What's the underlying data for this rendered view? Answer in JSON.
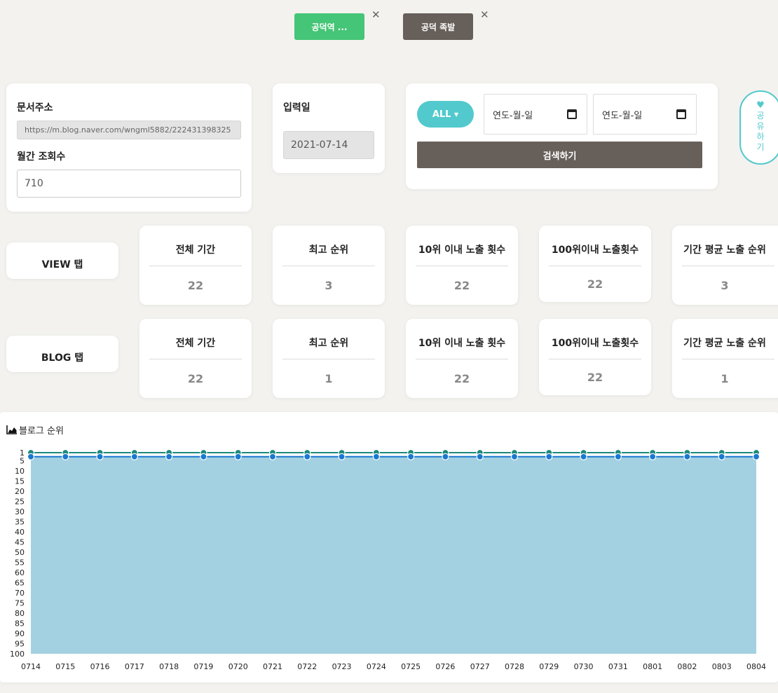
{
  "tags": [
    {
      "label": "공덕역 ...",
      "color": "#45c577"
    },
    {
      "label": "공덕 족발",
      "color": "#675f59"
    }
  ],
  "doc": {
    "url_label": "문서주소",
    "url_value": "https://m.blog.naver.com/wngml5882/222431398325",
    "views_label": "월간 조회수",
    "views_value": "710"
  },
  "entry": {
    "label": "입력일",
    "value": "2021-07-14"
  },
  "search": {
    "all_label": "ALL",
    "date_placeholder": "연도-월-일",
    "button_label": "검색하기"
  },
  "share": {
    "chars": [
      "공",
      "유",
      "하",
      "기"
    ]
  },
  "tabs": [
    {
      "label": "VIEW 탭",
      "stats": [
        {
          "title": "전체 기간",
          "value": "22"
        },
        {
          "title": "최고 순위",
          "value": "3"
        },
        {
          "title": "10위 이내 노출 횟수",
          "value": "22"
        },
        {
          "title": "100위이내 노출횟수",
          "value": "22"
        },
        {
          "title": "기간 평균 노출 순위",
          "value": "3"
        }
      ]
    },
    {
      "label": "BLOG 탭",
      "stats": [
        {
          "title": "전체 기간",
          "value": "22"
        },
        {
          "title": "최고 순위",
          "value": "1"
        },
        {
          "title": "10위 이내 노출 횟수",
          "value": "22"
        },
        {
          "title": "100위이내 노출횟수",
          "value": "22"
        },
        {
          "title": "기간 평균 노출 순위",
          "value": "1"
        }
      ]
    }
  ],
  "chart_data": {
    "type": "area",
    "title": "블로그 순위",
    "x": [
      "0714",
      "0715",
      "0716",
      "0717",
      "0718",
      "0719",
      "0720",
      "0721",
      "0722",
      "0723",
      "0724",
      "0725",
      "0726",
      "0727",
      "0728",
      "0729",
      "0730",
      "0731",
      "0801",
      "0802",
      "0803",
      "0804"
    ],
    "y_ticks": [
      1,
      5,
      10,
      15,
      20,
      25,
      30,
      35,
      40,
      45,
      50,
      55,
      60,
      65,
      70,
      75,
      80,
      85,
      90,
      95,
      100
    ],
    "ylim": [
      1,
      100
    ],
    "y_reversed": true,
    "series": [
      {
        "color": "#1c8a7a",
        "values": [
          1,
          1,
          1,
          1,
          1,
          1,
          1,
          1,
          1,
          1,
          1,
          1,
          1,
          1,
          1,
          1,
          1,
          1,
          1,
          1,
          1,
          1
        ]
      },
      {
        "color": "#1a78d0",
        "values": [
          3,
          3,
          3,
          3,
          3,
          3,
          3,
          3,
          3,
          3,
          3,
          3,
          3,
          3,
          3,
          3,
          3,
          3,
          3,
          3,
          3,
          3
        ]
      }
    ],
    "fill_color": "#a3d1e1"
  }
}
